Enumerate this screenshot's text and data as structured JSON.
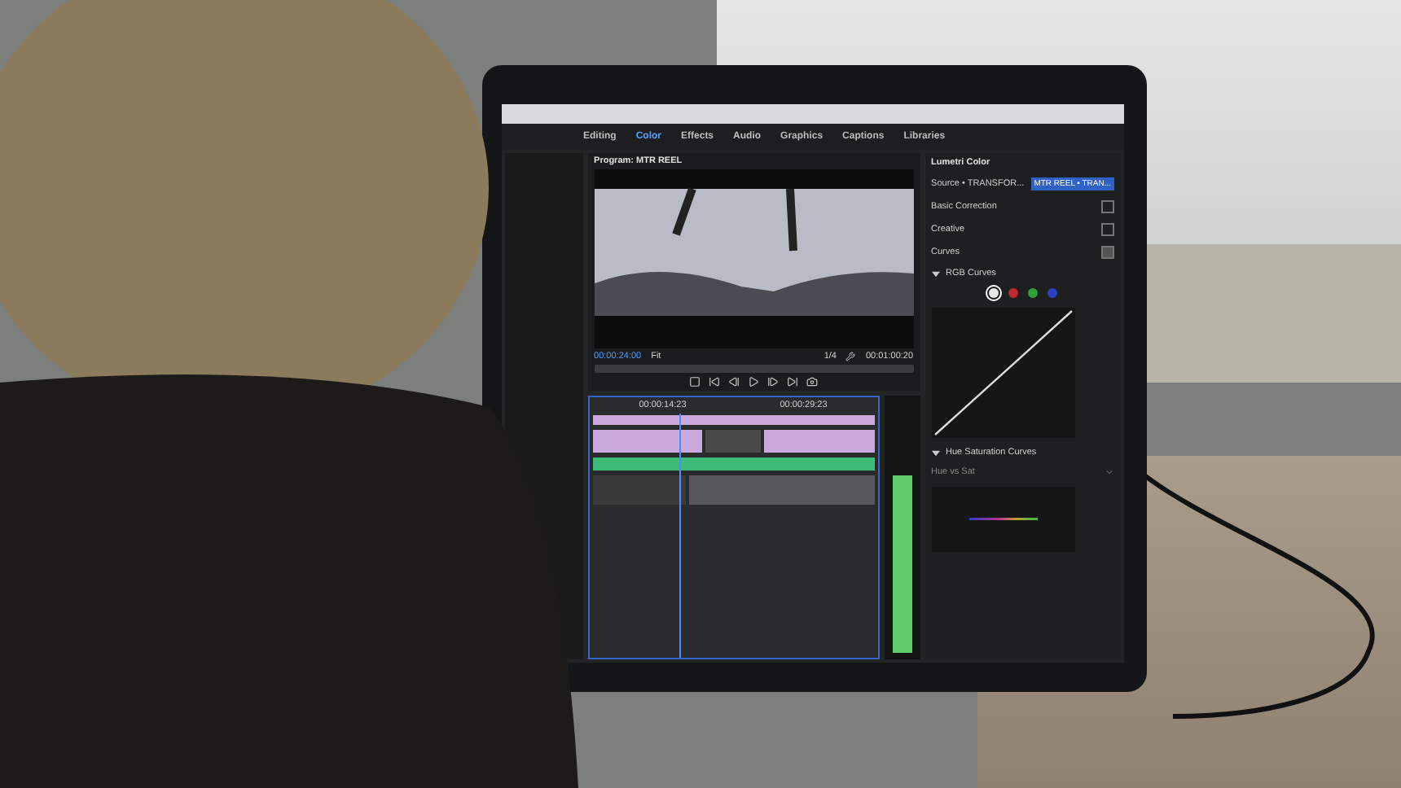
{
  "tabs": [
    {
      "label": "Editing",
      "selected": false
    },
    {
      "label": "Color",
      "selected": true
    },
    {
      "label": "Effects",
      "selected": false
    },
    {
      "label": "Audio",
      "selected": false
    },
    {
      "label": "Graphics",
      "selected": false
    },
    {
      "label": "Captions",
      "selected": false
    },
    {
      "label": "Libraries",
      "selected": false
    }
  ],
  "program_monitor": {
    "title": "Program: MTR REEL",
    "timecode": "00:00:24:00",
    "zoom": "Fit",
    "resolution": "1/4",
    "duration": "00:01:00:20"
  },
  "timeline": {
    "ruler": [
      "00:00:14:23",
      "00:00:29:23"
    ],
    "audio_meter": {
      "level": 0.75
    }
  },
  "lumetri": {
    "title": "Lumetri Color",
    "source": "Source • TRANSFOR...",
    "clip": "MTR REEL • TRAN...",
    "sections": [
      {
        "label": "Basic Correction",
        "expanded": false
      },
      {
        "label": "Creative",
        "expanded": false
      },
      {
        "label": "Curves",
        "expanded": true
      }
    ],
    "rgb_curves": {
      "label": "RGB Curves",
      "channels": [
        {
          "color": "#e8e8e8",
          "selected": true
        },
        {
          "color": "#c0282c",
          "selected": false
        },
        {
          "color": "#2f9e3a",
          "selected": false
        },
        {
          "color": "#2c3fc0",
          "selected": false
        }
      ]
    },
    "hue_saturation": {
      "label": "Hue Saturation Curves",
      "dropdown": "Hue vs Sat"
    }
  }
}
